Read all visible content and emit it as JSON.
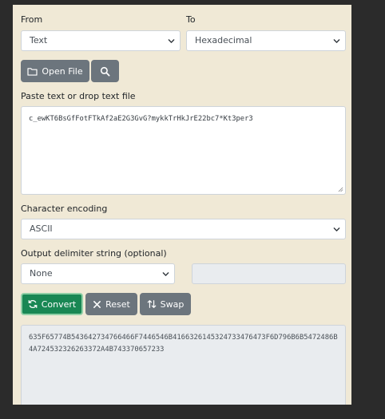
{
  "from": {
    "label": "From",
    "selected": "Text"
  },
  "to": {
    "label": "To",
    "selected": "Hexadecimal"
  },
  "toolbar": {
    "open_file_label": "Open File"
  },
  "input": {
    "label": "Paste text or drop text file",
    "value": "c_ewKT6BsGfFotFTkAf2aE2G3GvG?mykkTrHkJrE22bc7*Kt3per3"
  },
  "encoding": {
    "label": "Character encoding",
    "selected": "ASCII"
  },
  "delimiter": {
    "label": "Output delimiter string (optional)",
    "selected": "None",
    "custom_value": ""
  },
  "actions": {
    "convert_label": "Convert",
    "reset_label": "Reset",
    "swap_label": "Swap"
  },
  "output": {
    "value": "635F65774B543642734766466F7446546B4166326145324733476473F6D796B6B5472486B4A724532326263372A4B743370657233"
  },
  "colors": {
    "panel_bg": "#f0e9d6",
    "page_bg": "#2b2b2b",
    "button_gray": "#6c757d",
    "button_green": "#198754"
  }
}
